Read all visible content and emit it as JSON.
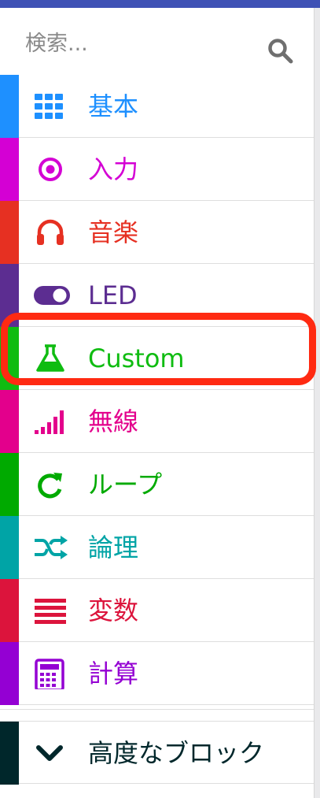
{
  "search": {
    "placeholder": "検索..."
  },
  "categories": [
    {
      "label": "基本",
      "icon": "grid-icon",
      "color": "#1e90ff"
    },
    {
      "label": "入力",
      "icon": "target-icon",
      "color": "#d400d4"
    },
    {
      "label": "音楽",
      "icon": "headphones-icon",
      "color": "#e63022"
    },
    {
      "label": "LED",
      "icon": "toggle-icon",
      "color": "#5c2d91"
    },
    {
      "label": "Custom",
      "icon": "flask-icon",
      "color": "#0fbc11"
    },
    {
      "label": "無線",
      "icon": "signal-bars-icon",
      "color": "#e3008c"
    },
    {
      "label": "ループ",
      "icon": "refresh-icon",
      "color": "#00aa00"
    },
    {
      "label": "論理",
      "icon": "shuffle-icon",
      "color": "#00a4a6"
    },
    {
      "label": "変数",
      "icon": "list-lines-icon",
      "color": "#dc143c"
    },
    {
      "label": "計算",
      "icon": "calculator-icon",
      "color": "#9400d3"
    }
  ],
  "advanced": {
    "label": "高度なブロック",
    "icon": "chevron-down-icon",
    "color": "#00272b"
  },
  "highlight_color": "#ff2a12",
  "header_color": "#3f51b5"
}
